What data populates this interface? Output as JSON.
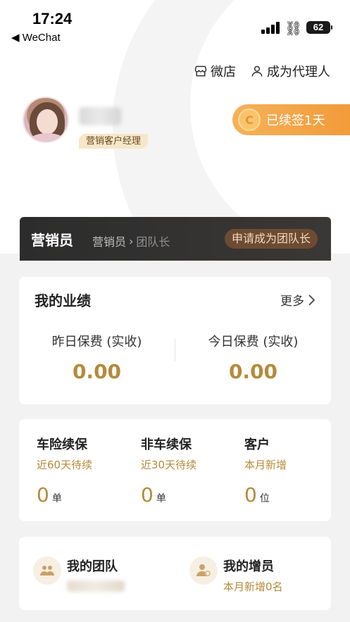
{
  "status_bar": {
    "time": "17:24",
    "back_label": "◀ WeChat",
    "battery": "62"
  },
  "header_links": {
    "shop_label": "微店",
    "agent_label": "成为代理人"
  },
  "profile": {
    "role_badge": "营销客户经理",
    "renew_label": "已续签1天",
    "renew_coin": "C"
  },
  "level": {
    "current": "营销员",
    "from": "营销员",
    "to": "团队长",
    "apply_label": "申请成为团队长"
  },
  "performance": {
    "title": "我的业绩",
    "more_label": "更多",
    "yesterday_label": "昨日保费 (实收)",
    "yesterday_value": "0.00",
    "today_label": "今日保费 (实收)",
    "today_value": "0.00"
  },
  "stats": [
    {
      "title": "车险续保",
      "sub": "近60天待续",
      "count": "0",
      "unit": "单"
    },
    {
      "title": "非车续保",
      "sub": "近30天待续",
      "count": "0",
      "unit": "单"
    },
    {
      "title": "客户",
      "sub": "本月新增",
      "count": "0",
      "unit": "位"
    }
  ],
  "team": {
    "my_team_title": "我的团队",
    "my_recruit_title": "我的增员",
    "recruit_sub": "本月新增0名"
  },
  "colors": {
    "accent_gold": "#b58a3a",
    "renew_orange": "#f29b3a",
    "level_bar_dark": "#2c2c2c"
  }
}
